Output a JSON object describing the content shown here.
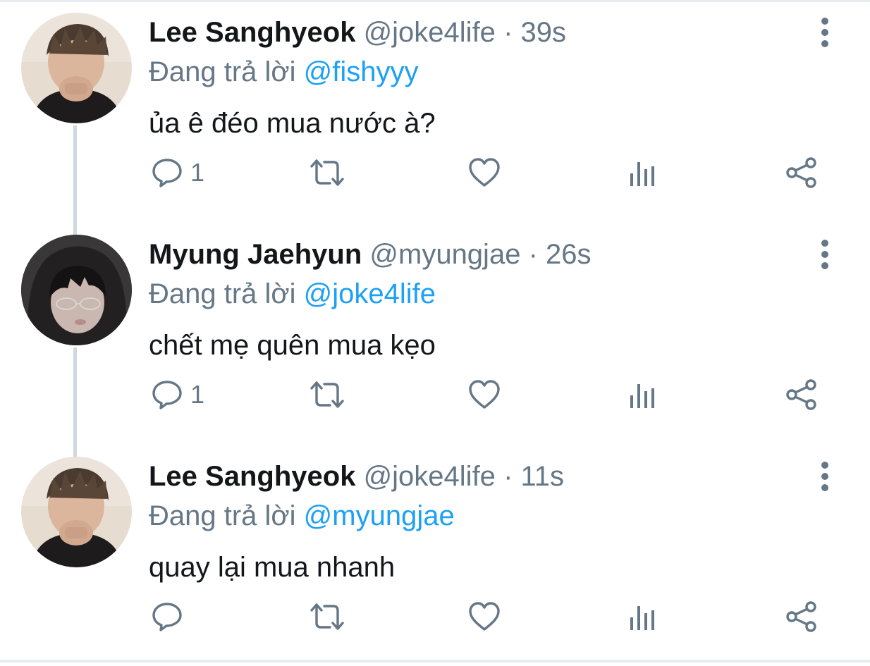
{
  "colors": {
    "accent": "#1da1f2",
    "secondary_text": "#657786",
    "primary_text": "#14171a",
    "thread_line": "#cfd9de"
  },
  "tweets": [
    {
      "name": "Lee Sanghyeok",
      "handle": "@joke4life",
      "separator": "·",
      "time": "39s",
      "replying_prefix": "Đang trả lời",
      "replying_to": "@fishyyy",
      "text": "ủa ê đéo mua nước à?",
      "reply_count": "1",
      "avatar_icon": "avatar-photo"
    },
    {
      "name": "Myung Jaehyun",
      "handle": "@myungjae",
      "separator": "·",
      "time": "26s",
      "replying_prefix": "Đang trả lời",
      "replying_to": "@joke4life",
      "text": "chết mẹ quên mua kẹo",
      "reply_count": "1",
      "avatar_icon": "avatar-photo"
    },
    {
      "name": "Lee Sanghyeok",
      "handle": "@joke4life",
      "separator": "·",
      "time": "11s",
      "replying_prefix": "Đang trả lời",
      "replying_to": "@myungjae",
      "text": "quay lại mua nhanh",
      "reply_count": "",
      "avatar_icon": "avatar-photo"
    }
  ],
  "action_icons": [
    "reply-icon",
    "retweet-icon",
    "like-icon",
    "analytics-icon",
    "share-icon"
  ],
  "more_icon": "more-options-icon"
}
